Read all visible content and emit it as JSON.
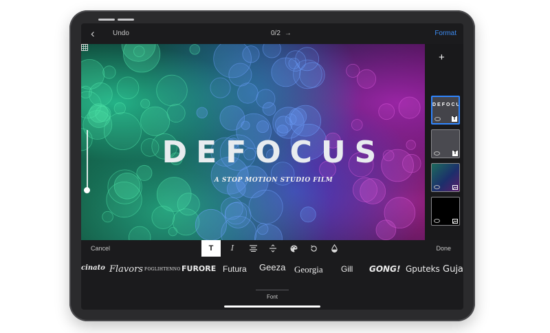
{
  "header": {
    "back_glyph": "‹",
    "undo_label": "Undo",
    "page_indicator": "0/2",
    "next_glyph": "→",
    "format_label": "Format"
  },
  "canvas": {
    "title": "DEFOCUS",
    "subtitle": "A STOP MOTION STUDIO FILM"
  },
  "sidebar": {
    "add_glyph": "+",
    "thumbnails": [
      {
        "text": "DEFOCUS",
        "badge": "T",
        "selected": true
      },
      {
        "text": "",
        "badge": "T",
        "selected": false
      },
      {
        "text": "",
        "badge": "",
        "selected": false
      },
      {
        "text": "",
        "badge": "",
        "selected": false
      }
    ]
  },
  "toolbar": {
    "cancel_label": "Cancel",
    "done_label": "Done",
    "text_tool": "T",
    "italic_tool": "I"
  },
  "fonts": {
    "items": [
      "cinato",
      "Flavors",
      "FOGLIHTENNO",
      "FURORE",
      "Futura",
      "Geeza",
      "Georgia",
      "Gill",
      "GONG!",
      "Gputeks",
      "Guja"
    ],
    "tab_label": "Font"
  },
  "colors": {
    "accent": "#3d8df5",
    "selection": "#2f86ff",
    "background": "#1b1b1d"
  }
}
